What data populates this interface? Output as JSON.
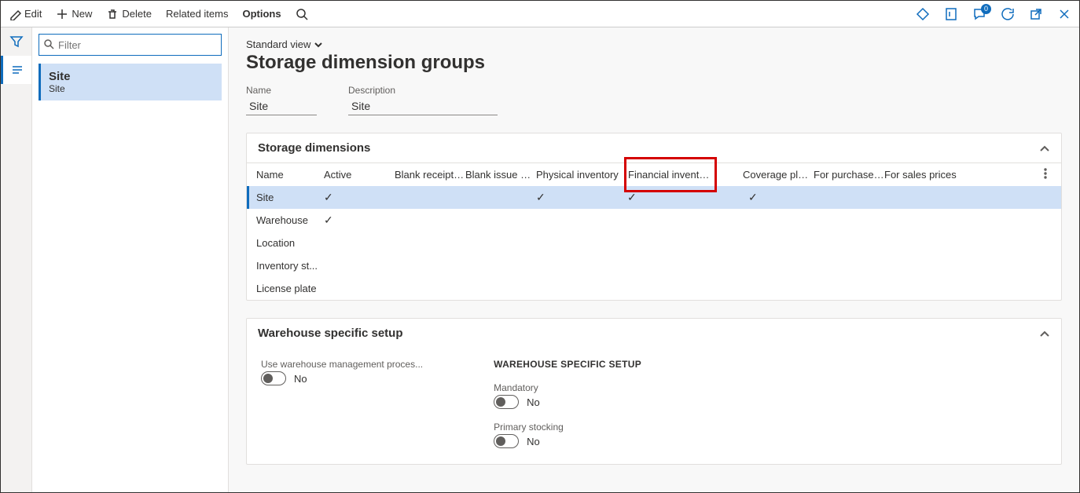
{
  "toolbar": {
    "edit": "Edit",
    "new": "New",
    "delete": "Delete",
    "related": "Related items",
    "options": "Options",
    "notif_count": "0"
  },
  "list": {
    "filter_placeholder": "Filter",
    "item": {
      "title": "Site",
      "sub": "Site"
    }
  },
  "header": {
    "view_label": "Standard view",
    "page_title": "Storage dimension groups",
    "name_label": "Name",
    "name_value": "Site",
    "desc_label": "Description",
    "desc_value": "Site"
  },
  "storage_dim": {
    "section_title": "Storage dimensions",
    "columns": {
      "name": "Name",
      "active": "Active",
      "blank_receipt": "Blank receipt a...",
      "blank_issue": "Blank issue all...",
      "physical": "Physical inventory",
      "financial": "Financial inventory",
      "coverage": "Coverage plan ...",
      "purchase": "For purchase p...",
      "sales": "For sales prices"
    },
    "rows": [
      {
        "name": "Site",
        "active": true,
        "physical": true,
        "financial": true,
        "coverage": true,
        "selected": true
      },
      {
        "name": "Warehouse",
        "active": true
      },
      {
        "name": "Location"
      },
      {
        "name": "Inventory st..."
      },
      {
        "name": "License plate"
      }
    ]
  },
  "warehouse": {
    "section_title": "Warehouse specific setup",
    "use_wh_label": "Use warehouse management proces...",
    "use_wh_value": "No",
    "group_label": "WAREHOUSE SPECIFIC SETUP",
    "mandatory_label": "Mandatory",
    "mandatory_value": "No",
    "primary_label": "Primary stocking",
    "primary_value": "No"
  }
}
